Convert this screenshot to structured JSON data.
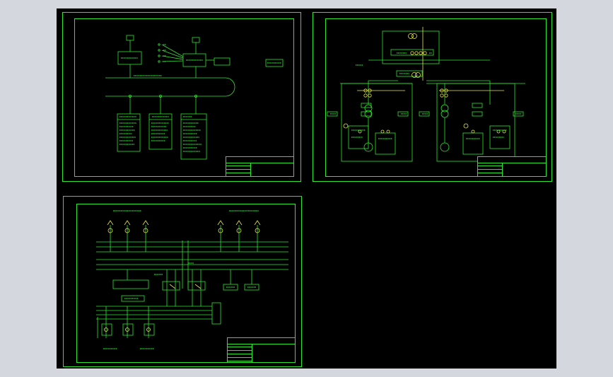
{
  "canvas": {
    "background": "#000000",
    "line_color": "#2ee52e",
    "accent_color": "#e8e84a"
  },
  "sheets": [
    {
      "id": "sheet-1",
      "title_block": {
        "organization": "",
        "drawing_title": ""
      },
      "text_labels": []
    },
    {
      "id": "sheet-2",
      "title_block": {
        "organization": "",
        "drawing_title": ""
      },
      "text_labels": []
    },
    {
      "id": "sheet-3",
      "title_block": {
        "organization": "",
        "drawing_title": ""
      },
      "text_labels": []
    }
  ]
}
